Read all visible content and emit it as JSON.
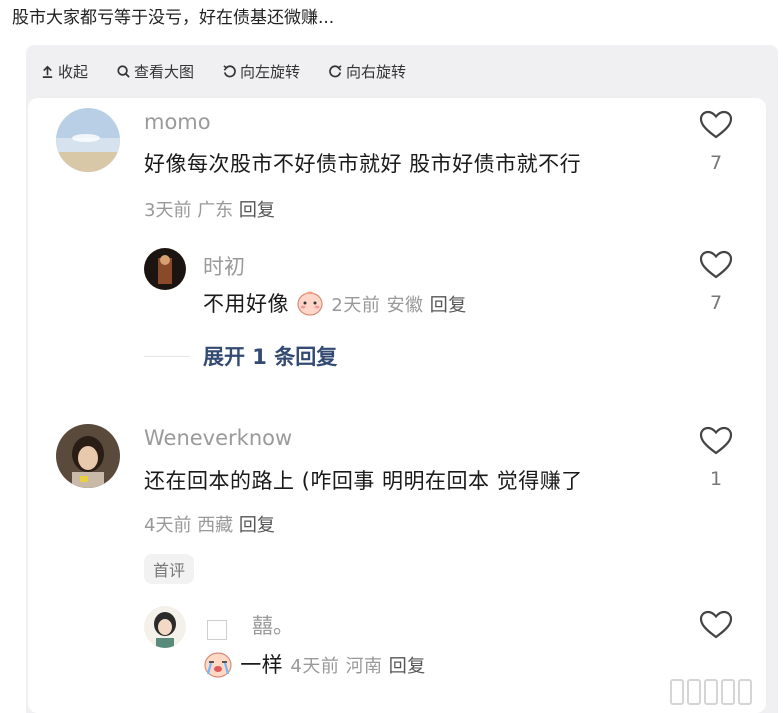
{
  "post": {
    "title": "股市大家都亏等于没亏，好在债基还微赚..."
  },
  "toolbar": {
    "collapse": "收起",
    "view_full": "查看大图",
    "rotate_left": "向左旋转",
    "rotate_right": "向右旋转"
  },
  "comments": [
    {
      "user": "momo",
      "text": "好像每次股市不好债市就好 股市好债市就不行",
      "time": "3天前",
      "location": "广东",
      "reply": "回复",
      "likes": "7"
    },
    {
      "user": "时初",
      "text": "不用好像",
      "time": "2天前",
      "location": "安徽",
      "reply": "回复",
      "likes": "7"
    },
    {
      "user": "Weneverknow",
      "text": "还在回本的路上 (咋回事 明明在回本 觉得赚了",
      "time": "4天前",
      "location": "西藏",
      "reply": "回复",
      "likes": "1",
      "badge": "首评"
    },
    {
      "user": "囍。",
      "text": "一样",
      "time": "4天前",
      "location": "河南",
      "reply": "回复"
    }
  ],
  "expand_label": "展开 1 条回复",
  "icons": {
    "collapse": "arrow-up-icon",
    "view": "magnifier-icon",
    "rotate_left": "rotate-left-icon",
    "rotate_right": "rotate-right-icon",
    "like": "heart-icon",
    "emoji_shy": "shy-face-emoji",
    "emoji_cry": "crying-face-emoji"
  },
  "colors": {
    "viewer_bg": "#f0f0f2",
    "expand_text": "#334a73",
    "meta_text": "#999999"
  }
}
